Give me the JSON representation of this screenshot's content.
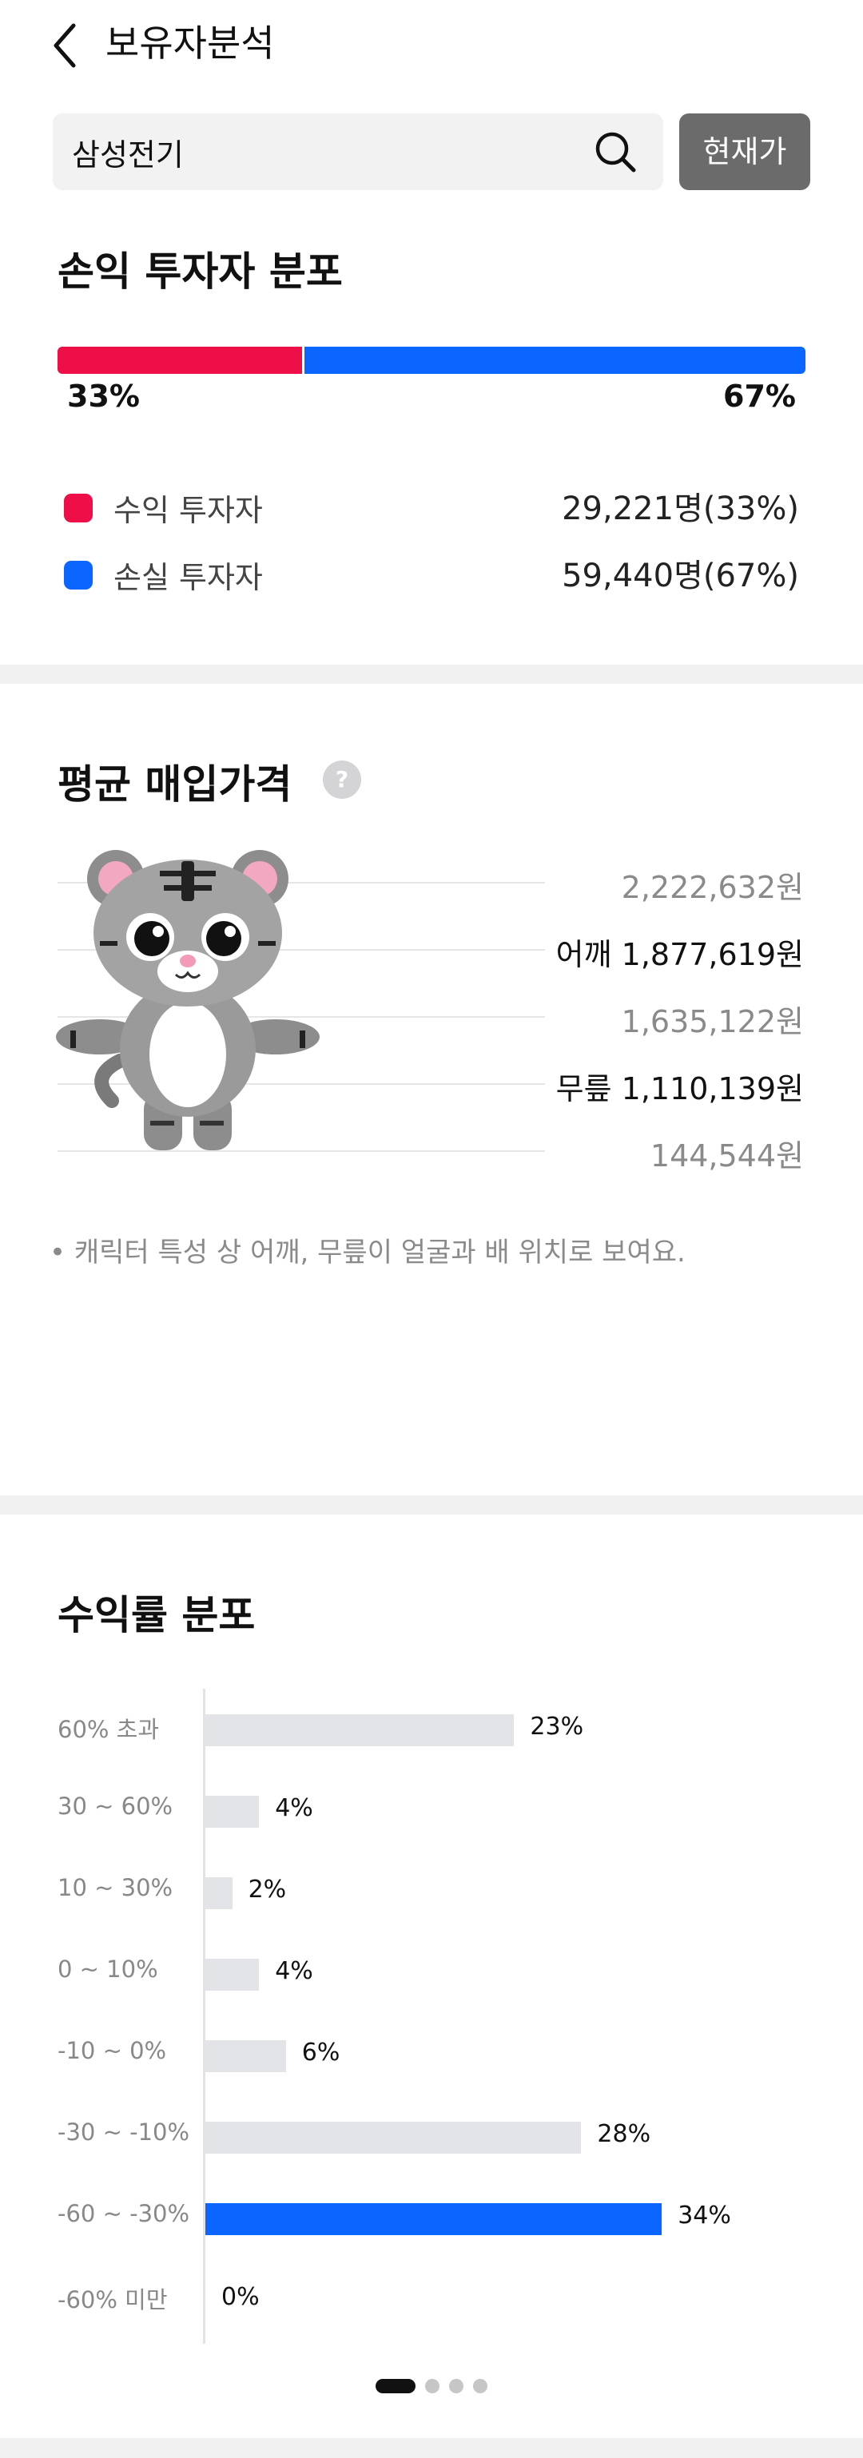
{
  "header": {
    "title": "보유자분석",
    "back_icon": "chevron-left-icon"
  },
  "search": {
    "value": "삼성전기",
    "icon": "search-icon",
    "button_label": "현재가"
  },
  "profit_distribution": {
    "title": "손익 투자자 분포",
    "profit_pct_label": "33%",
    "loss_pct_label": "67%",
    "profit_fraction": 0.33,
    "colors": {
      "profit": "#ee0e48",
      "loss": "#0a66ff"
    },
    "legend": [
      {
        "label": "수익 투자자",
        "value": "29,221명(33%)",
        "color": "#ee0e48"
      },
      {
        "label": "손실 투자자",
        "value": "59,440명(67%)",
        "color": "#0a66ff"
      }
    ]
  },
  "avg_price": {
    "title": "평균 매입가격",
    "help_icon": "?",
    "levels": [
      {
        "label": "2,222,632원",
        "emphasis": false
      },
      {
        "label": "어깨 1,877,619원",
        "emphasis": true
      },
      {
        "label": "1,635,122원",
        "emphasis": false
      },
      {
        "label": "무릎 1,110,139원",
        "emphasis": true
      },
      {
        "label": "144,544원",
        "emphasis": false
      }
    ],
    "character_icon": "tiger-character-icon",
    "note": "• 캐릭터 특성 상 어깨, 무릎이 얼굴과 배 위치로 보여요."
  },
  "return_distribution": {
    "title": "수익률 분포",
    "chart_data": {
      "type": "bar",
      "orientation": "horizontal",
      "categories": [
        "60% 초과",
        "30 ~ 60%",
        "10 ~ 30%",
        "0 ~ 10%",
        "-10 ~ 0%",
        "-30 ~ -10%",
        "-60 ~ -30%",
        "-60% 미만"
      ],
      "values": [
        23,
        4,
        2,
        4,
        6,
        28,
        34,
        0
      ],
      "value_labels": [
        "23%",
        "4%",
        "2%",
        "4%",
        "6%",
        "28%",
        "34%",
        "0%"
      ],
      "highlight_index": 6,
      "colors": {
        "default": "#e3e4e8",
        "highlight": "#0a66ff"
      }
    }
  },
  "pager": {
    "count": 4,
    "active": 0
  }
}
